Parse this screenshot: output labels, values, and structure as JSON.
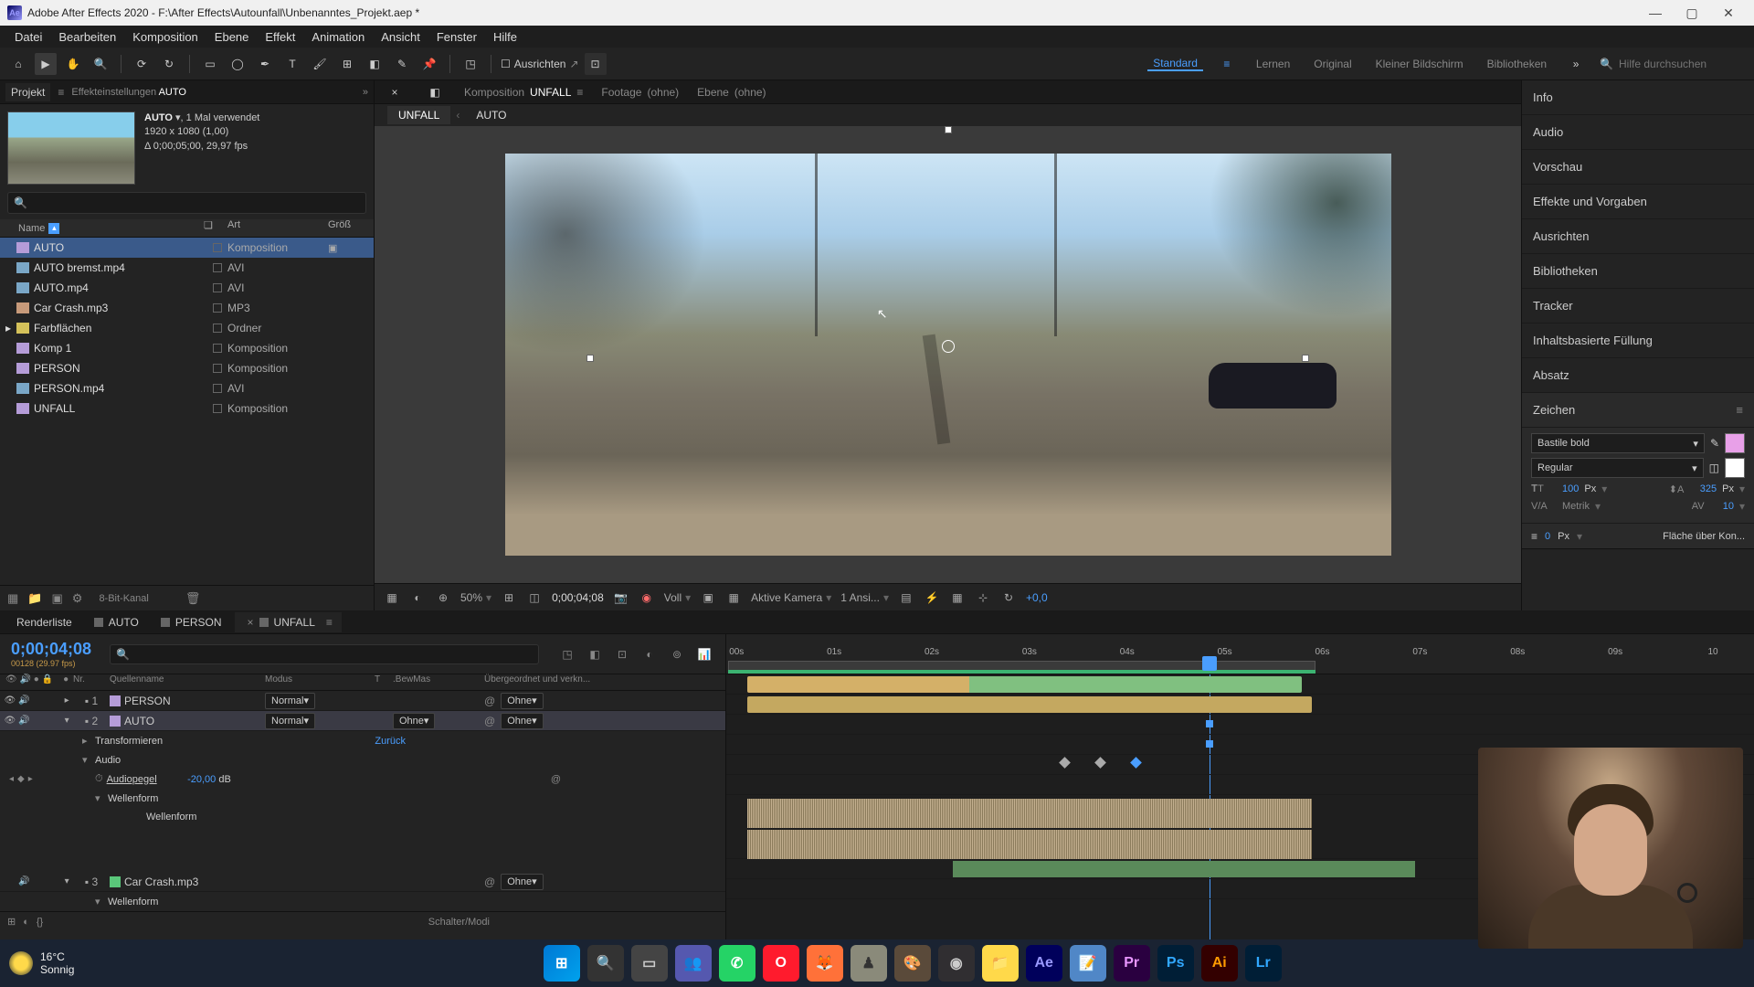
{
  "app": {
    "title": "Adobe After Effects 2020 - F:\\After Effects\\Autounfall\\Unbenanntes_Projekt.aep *"
  },
  "menu": [
    "Datei",
    "Bearbeiten",
    "Komposition",
    "Ebene",
    "Effekt",
    "Animation",
    "Ansicht",
    "Fenster",
    "Hilfe"
  ],
  "toolbar": {
    "ausrichten": "Ausrichten",
    "search_placeholder": "Hilfe durchsuchen"
  },
  "workspaces": [
    "Standard",
    "Lernen",
    "Original",
    "Kleiner Bildschirm",
    "Bibliotheken"
  ],
  "projectPanel": {
    "tabs": {
      "project": "Projekt",
      "effect": "Effekteinstellungen",
      "effect_source": "AUTO"
    },
    "meta": {
      "name": "AUTO",
      "used": ", 1 Mal verwendet",
      "dims": "1920 x 1080 (1,00)",
      "dur": "Δ 0;00;05;00, 29,97 fps"
    },
    "columns": {
      "name": "Name",
      "type": "Art",
      "size": "Größ"
    },
    "bitdepth": "8-Bit-Kanal",
    "items": [
      {
        "name": "AUTO",
        "type": "Komposition",
        "icon": "comp",
        "selected": true,
        "used": "▣"
      },
      {
        "name": "AUTO bremst.mp4",
        "type": "AVI",
        "icon": "avi"
      },
      {
        "name": "AUTO.mp4",
        "type": "AVI",
        "icon": "avi"
      },
      {
        "name": "Car Crash.mp3",
        "type": "MP3",
        "icon": "mp3"
      },
      {
        "name": "Farbflächen",
        "type": "Ordner",
        "icon": "folder",
        "expand": true
      },
      {
        "name": "Komp 1",
        "type": "Komposition",
        "icon": "comp"
      },
      {
        "name": "PERSON",
        "type": "Komposition",
        "icon": "comp"
      },
      {
        "name": "PERSON.mp4",
        "type": "AVI",
        "icon": "avi"
      },
      {
        "name": "UNFALL",
        "type": "Komposition",
        "icon": "comp"
      }
    ]
  },
  "compPanel": {
    "tab_label": "Komposition",
    "tab_comp": "UNFALL",
    "footage": "Footage",
    "footage_none": "(ohne)",
    "ebene": "Ebene",
    "ebene_none": "(ohne)",
    "crumbs": [
      "UNFALL",
      "AUTO"
    ],
    "footer": {
      "zoom": "50%",
      "timecode": "0;00;04;08",
      "res": "Voll",
      "camera": "Aktive Kamera",
      "views": "1 Ansi...",
      "exposure": "+0,0"
    }
  },
  "rightPanels": {
    "sections": [
      "Info",
      "Audio",
      "Vorschau",
      "Effekte und Vorgaben",
      "Ausrichten",
      "Bibliotheken",
      "Tracker",
      "Inhaltsbasierte Füllung",
      "Absatz"
    ],
    "zeichen": {
      "title": "Zeichen",
      "font": "Bastile bold",
      "weight": "Regular",
      "size": "100",
      "size_unit": "Px",
      "leading": "325",
      "leading_unit": "Px",
      "kerning": "Metrik",
      "tracking": "10",
      "stroke": "0",
      "stroke_unit": "Px",
      "stroke_opt": "Fläche über Kon..."
    }
  },
  "timeline": {
    "tabs": [
      {
        "name": "Renderliste"
      },
      {
        "name": "AUTO"
      },
      {
        "name": "PERSON"
      },
      {
        "name": "UNFALL",
        "active": true
      }
    ],
    "timecode": "0;00;04;08",
    "timecode_sub": "00128 (29.97 fps)",
    "columns": {
      "nr": "Nr.",
      "source": "Quellenname",
      "modus": "Modus",
      "t": "T",
      "bew": ".BewMas",
      "parent": "Übergeordnet und verkn..."
    },
    "layers": [
      {
        "nr": "1",
        "name": "PERSON",
        "modus": "Normal",
        "parent": "Ohne",
        "selected": false,
        "type": "comp"
      },
      {
        "nr": "2",
        "name": "AUTO",
        "modus": "Normal",
        "bew": "Ohne",
        "parent": "Ohne",
        "selected": true,
        "type": "comp"
      },
      {
        "nr": "3",
        "name": "Car Crash.mp3",
        "parent": "Ohne",
        "type": "audio"
      }
    ],
    "props": {
      "transform": "Transformieren",
      "reset": "Zurück",
      "audio": "Audio",
      "audiolevels": "Audiopegel",
      "audiolevels_val": "-20,00",
      "db": "dB",
      "waveform": "Wellenform"
    },
    "footer": {
      "schalter": "Schalter/Modi"
    },
    "ruler": [
      "00s",
      "01s",
      "02s",
      "03s",
      "04s",
      "05s",
      "06s",
      "07s",
      "08s",
      "09s",
      "10"
    ]
  },
  "taskbar": {
    "weather_temp": "16°C",
    "weather_desc": "Sonnig"
  }
}
